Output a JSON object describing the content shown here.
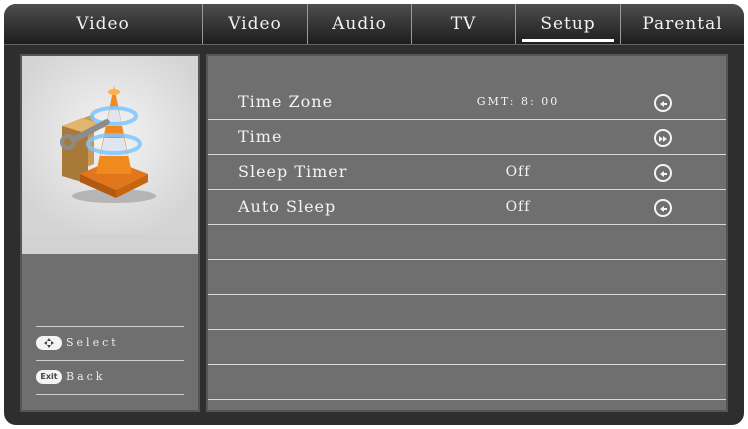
{
  "header": {
    "title": "Video",
    "tabs": [
      {
        "label": "Video"
      },
      {
        "label": "Audio"
      },
      {
        "label": "TV"
      },
      {
        "label": "Setup"
      },
      {
        "label": "Parental"
      }
    ],
    "active_tab": "Setup"
  },
  "settings": [
    {
      "label": "Time Zone",
      "value": "GMT: 8: 00",
      "action_icon": "enter-icon"
    },
    {
      "label": "Time",
      "value": "",
      "action_icon": "submenu-icon"
    },
    {
      "label": "Sleep Timer",
      "value": "Off",
      "action_icon": "enter-icon"
    },
    {
      "label": "Auto Sleep",
      "value": "Off",
      "action_icon": "enter-icon"
    }
  ],
  "hints": [
    {
      "button": "",
      "button_icon": "dpad-icon",
      "label": "Select"
    },
    {
      "button": "Exit",
      "label": "Back"
    }
  ],
  "thumbnail_icon": "vlc-cone-icon"
}
